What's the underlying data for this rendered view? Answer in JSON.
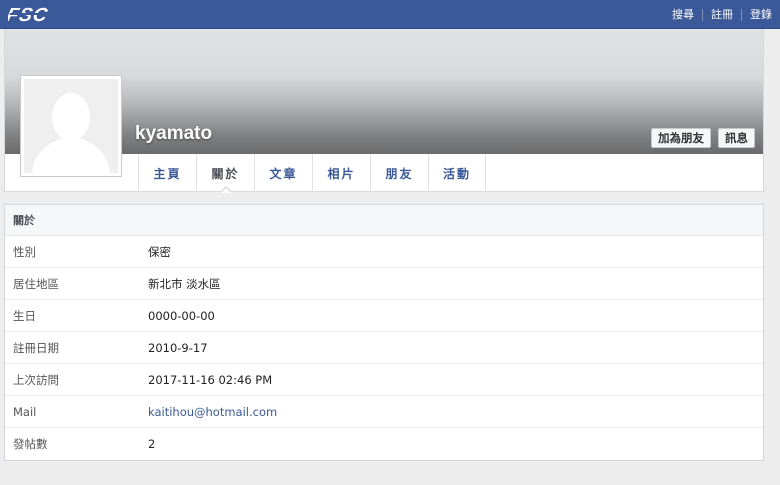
{
  "header": {
    "logo_text": "FSC",
    "links": [
      "搜尋",
      "註冊",
      "登錄"
    ]
  },
  "profile": {
    "username": "kyamato",
    "buttons": {
      "add_friend": "加為朋友",
      "message": "訊息"
    },
    "tabs": [
      {
        "label": "主頁",
        "active": false
      },
      {
        "label": "關於",
        "active": true
      },
      {
        "label": "文章",
        "active": false
      },
      {
        "label": "相片",
        "active": false
      },
      {
        "label": "朋友",
        "active": false
      },
      {
        "label": "活動",
        "active": false
      }
    ]
  },
  "about": {
    "heading": "關於",
    "rows": [
      {
        "label": "性別",
        "value": "保密"
      },
      {
        "label": "居住地區",
        "value": "新北市 淡水區"
      },
      {
        "label": "生日",
        "value": "0000-00-00"
      },
      {
        "label": "註冊日期",
        "value": "2010-9-17"
      },
      {
        "label": "上次訪問",
        "value": "2017-11-16 02:46 PM"
      },
      {
        "label": "Mail",
        "value": "kaitihou@hotmail.com"
      },
      {
        "label": "發帖數",
        "value": "2"
      }
    ]
  },
  "colors": {
    "brand": "#3b5998",
    "link": "#3b5998"
  }
}
